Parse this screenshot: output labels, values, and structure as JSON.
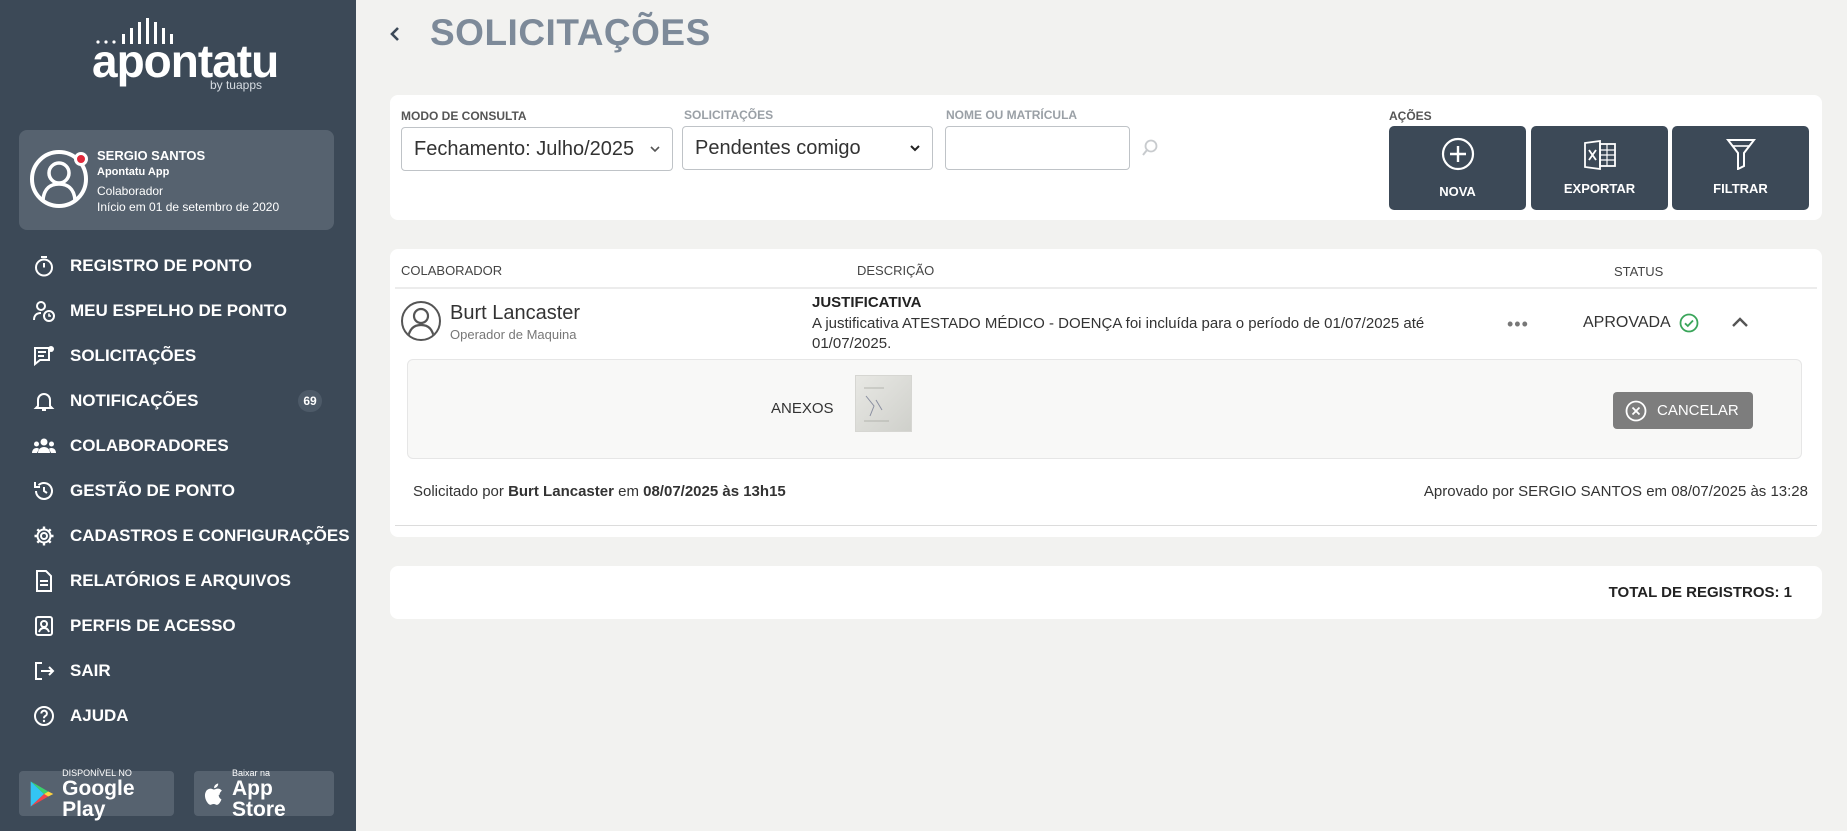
{
  "brand": {
    "name": "apontatu",
    "by": "by tuapps"
  },
  "profile": {
    "name": "SERGIO SANTOS",
    "company": "Apontatu App",
    "role": "Colaborador",
    "since": "Início em 01 de setembro de 2020"
  },
  "nav": [
    {
      "label": "REGISTRO DE PONTO",
      "icon": "stopwatch-icon"
    },
    {
      "label": "MEU ESPELHO DE PONTO",
      "icon": "user-clock-icon"
    },
    {
      "label": "SOLICITAÇÕES",
      "icon": "request-icon"
    },
    {
      "label": "NOTIFICAÇÕES",
      "icon": "bell-icon",
      "badge": "69"
    },
    {
      "label": "COLABORADORES",
      "icon": "team-icon"
    },
    {
      "label": "GESTÃO DE PONTO",
      "icon": "clock-history-icon"
    },
    {
      "label": "CADASTROS E CONFIGURAÇÕES",
      "icon": "gear-icon"
    },
    {
      "label": "RELATÓRIOS E ARQUIVOS",
      "icon": "document-icon"
    },
    {
      "label": "PERFIS DE ACESSO",
      "icon": "id-badge-icon"
    },
    {
      "label": "SAIR",
      "icon": "logout-icon"
    },
    {
      "label": "AJUDA",
      "icon": "help-icon"
    }
  ],
  "stores": {
    "google": {
      "line1": "DISPONÍVEL NO",
      "line2": "Google Play"
    },
    "apple": {
      "line1": "Baixar na",
      "line2": "App Store"
    }
  },
  "page": {
    "title": "SOLICITAÇÕES"
  },
  "filters": {
    "mode_label": "MODO DE CONSULTA",
    "mode_value": "Fechamento: Julho/2025",
    "requests_label": "SOLICITAÇÕES",
    "requests_value": "Pendentes comigo",
    "name_label": "NOME OU MATRÍCULA",
    "name_value": "",
    "actions_label": "AÇÕES"
  },
  "actions": {
    "new": "NOVA",
    "export": "EXPORTAR",
    "filter": "FILTRAR"
  },
  "table": {
    "columns": {
      "employee": "COLABORADOR",
      "description": "DESCRIÇÃO",
      "status": "STATUS"
    },
    "rows": [
      {
        "name": "Burt Lancaster",
        "role": "Operador de Maquina",
        "type": "JUSTIFICATIVA",
        "description": "A justificativa ATESTADO MÉDICO - DOENÇA foi incluída para o período de 01/07/2025 até 01/07/2025.",
        "status": "APROVADA",
        "attachments_label": "ANEXOS",
        "cancel_label": "CANCELAR",
        "requested_prefix": "Solicitado por",
        "requested_by": "Burt Lancaster",
        "requested_mid": "em",
        "requested_at": "08/07/2025 às 13h15",
        "approved_text": "Aprovado por SERGIO SANTOS em 08/07/2025 às 13:28"
      }
    ]
  },
  "total": "TOTAL DE REGISTROS: 1",
  "colors": {
    "sidebar": "#3c4957",
    "profile_card": "#56626f",
    "title": "#7d8a99",
    "success": "#3aa55a",
    "alert": "#e0283a"
  }
}
